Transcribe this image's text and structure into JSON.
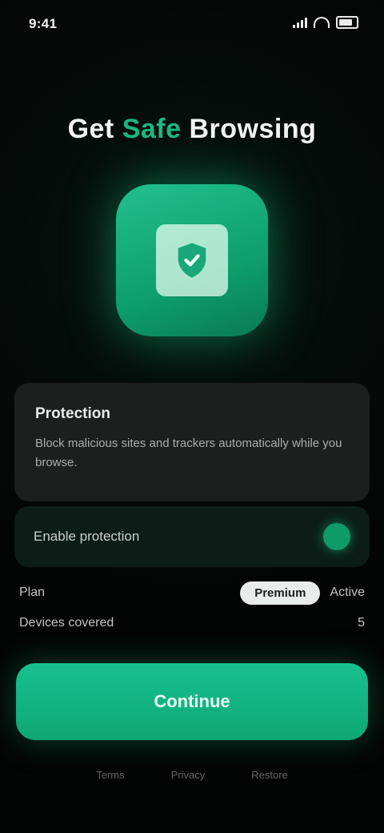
{
  "status_bar": {
    "time": "9:41"
  },
  "headline": {
    "part1": "Get",
    "accent": "Safe",
    "part2": "Browsing"
  },
  "info_card": {
    "title": "Protection",
    "body": "Block malicious sites and trackers automatically while you browse."
  },
  "toggle": {
    "label": "Enable protection",
    "state": "on"
  },
  "rows": [
    {
      "label": "Plan",
      "pill": "Premium",
      "value": "Active"
    },
    {
      "label": "Devices covered",
      "value": "5"
    }
  ],
  "primary_button": {
    "label": "Continue"
  },
  "footer": {
    "links": [
      "Terms",
      "Privacy",
      "Restore"
    ]
  },
  "colors": {
    "accent": "#19b883",
    "background": "#030504",
    "card": "#1b1f1d"
  },
  "icons": {
    "hero": "shield-icon"
  }
}
